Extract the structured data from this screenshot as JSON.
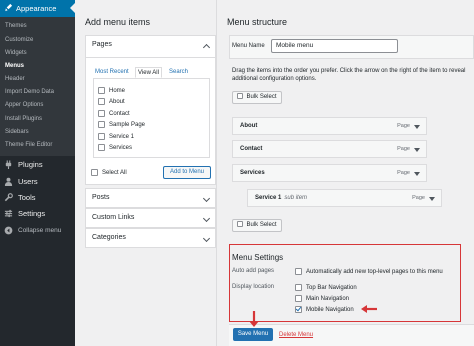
{
  "sidebar": {
    "header": {
      "label": "Appearance",
      "icon": "paintbrush-icon"
    },
    "submenu": [
      {
        "label": "Themes",
        "current": false
      },
      {
        "label": "Customize",
        "current": false
      },
      {
        "label": "Widgets",
        "current": false
      },
      {
        "label": "Menus",
        "current": true
      },
      {
        "label": "Header",
        "current": false
      },
      {
        "label": "Import Demo Data",
        "current": false
      },
      {
        "label": "Apper Options",
        "current": false
      },
      {
        "label": "Install Plugins",
        "current": false
      },
      {
        "label": "Sidebars",
        "current": false
      },
      {
        "label": "Theme File Editor",
        "current": false
      }
    ],
    "main": [
      {
        "label": "Plugins",
        "icon": "plugin-icon"
      },
      {
        "label": "Users",
        "icon": "users-icon"
      },
      {
        "label": "Tools",
        "icon": "wrench-icon"
      },
      {
        "label": "Settings",
        "icon": "settings-icon"
      }
    ],
    "collapse_label": "Collapse menu"
  },
  "add_items": {
    "title": "Add menu items",
    "pages_panel": {
      "title": "Pages",
      "tabs": [
        "Most Recent",
        "View All",
        "Search"
      ],
      "active_tab": "View All",
      "pages": [
        "Home",
        "About",
        "Contact",
        "Sample Page",
        "Service 1",
        "Services"
      ],
      "select_all_label": "Select All",
      "add_button": "Add to Menu"
    },
    "other_panels": [
      "Posts",
      "Custom Links",
      "Categories"
    ]
  },
  "structure": {
    "title": "Menu structure",
    "menu_name_label": "Menu Name",
    "menu_name_value": "Mobile menu",
    "help_text": "Drag the items into the order you prefer. Click the arrow on the right of the item to reveal additional configuration options.",
    "bulk_select": "Bulk Select",
    "items": [
      {
        "title": "About",
        "type": "Page",
        "subtitle": ""
      },
      {
        "title": "Contact",
        "type": "Page",
        "subtitle": ""
      },
      {
        "title": "Services",
        "type": "Page",
        "subtitle": ""
      },
      {
        "title": "Service 1",
        "type": "Page",
        "subtitle": "sub item"
      }
    ],
    "settings": {
      "title": "Menu Settings",
      "auto_add_label": "Auto add pages",
      "auto_add_option": "Automatically add new top-level pages to this menu",
      "display_location_label": "Display location",
      "locations": [
        {
          "label": "Top Bar Navigation",
          "checked": false
        },
        {
          "label": "Main Navigation",
          "checked": false
        },
        {
          "label": "Mobile Navigation",
          "checked": true
        }
      ]
    },
    "save_button": "Save Menu",
    "delete_link": "Delete Menu"
  },
  "colors": {
    "accent": "#2271b1",
    "sidebar_bg": "#23282d",
    "sidebar_active": "#0073aa",
    "highlight_red": "#d63638"
  }
}
